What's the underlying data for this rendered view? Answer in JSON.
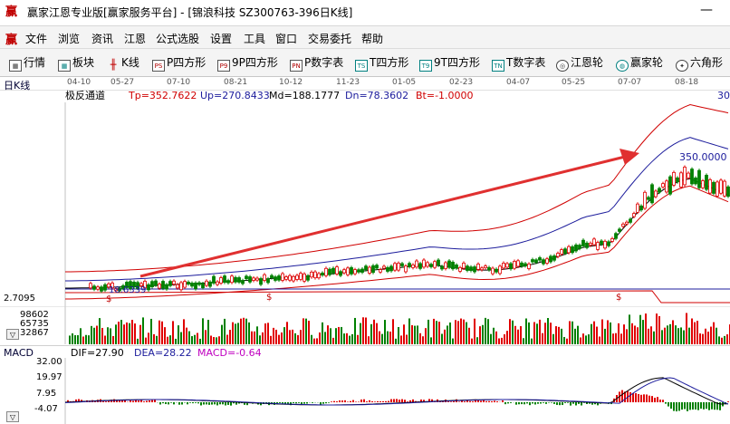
{
  "window": {
    "logo": "赢",
    "title": "赢家江恩专业版[赢家服务平台] - [锦浪科技  SZ300763-396日K线]",
    "minimize": "—"
  },
  "menu": {
    "logo": "赢",
    "items": [
      "文件",
      "浏览",
      "资讯",
      "江恩",
      "公式选股",
      "设置",
      "工具",
      "窗口",
      "交易委托",
      "帮助"
    ]
  },
  "toolbar": {
    "items": [
      {
        "label": "行情",
        "icon": "grid-icon",
        "glyph": "▦"
      },
      {
        "label": "板块",
        "icon": "blocks-icon",
        "glyph": "▦"
      },
      {
        "label": "K线",
        "icon": "candlestick-icon",
        "glyph": "╫"
      },
      {
        "label": "P四方形",
        "icon": "ps-icon",
        "glyph": "PS"
      },
      {
        "label": "9P四方形",
        "icon": "p9-icon",
        "glyph": "P9"
      },
      {
        "label": "P数字表",
        "icon": "pn-icon",
        "glyph": "PN"
      },
      {
        "label": "T四方形",
        "icon": "ts-icon",
        "glyph": "TS"
      },
      {
        "label": "9T四方形",
        "icon": "t9-icon",
        "glyph": "T9"
      },
      {
        "label": "T数字表",
        "icon": "tn-icon",
        "glyph": "TN"
      },
      {
        "label": "江恩轮",
        "icon": "gann-wheel-icon",
        "glyph": "◎"
      },
      {
        "label": "赢家轮",
        "icon": "winner-wheel-icon",
        "glyph": "◍"
      },
      {
        "label": "六角形",
        "icon": "hexagon-icon",
        "glyph": "✦"
      }
    ]
  },
  "chart_header": {
    "period_label": "日K线",
    "dates": [
      "04-10",
      "05-27",
      "07-10",
      "08-21",
      "10-12",
      "11-23",
      "01-05",
      "02-23",
      "04-07",
      "05-25",
      "07-07",
      "08-18"
    ]
  },
  "indicator": {
    "name": "极反通道",
    "tp": "Tp=352.7622",
    "up": "Up=270.8433",
    "md": "Md=188.1777",
    "dn": "Dn=78.3602",
    "bt": "Bt=-1.0000",
    "top_right_value": "30",
    "low_label": "18.6339",
    "high_label": "350.0000",
    "price_axis_low": "2.7095",
    "signal_glyph": "$",
    "down_arrow": "▽"
  },
  "volume": {
    "axis": [
      "98602",
      "65735",
      "32867"
    ]
  },
  "macd": {
    "name": "MACD",
    "dif": "DIF=27.90",
    "dea": "DEA=28.22",
    "macd": "MACD=-0.64",
    "axis": [
      "32.00",
      "19.97",
      "7.95",
      "-4.07"
    ]
  },
  "colors": {
    "up": "#e00000",
    "down": "#008000",
    "band_outer": "#d00000",
    "band_mid": "#1c1c9c",
    "arrow": "#e03030",
    "dea": "#1c1c9c",
    "dif": "#000000",
    "macd_label": "#c000c0"
  }
}
